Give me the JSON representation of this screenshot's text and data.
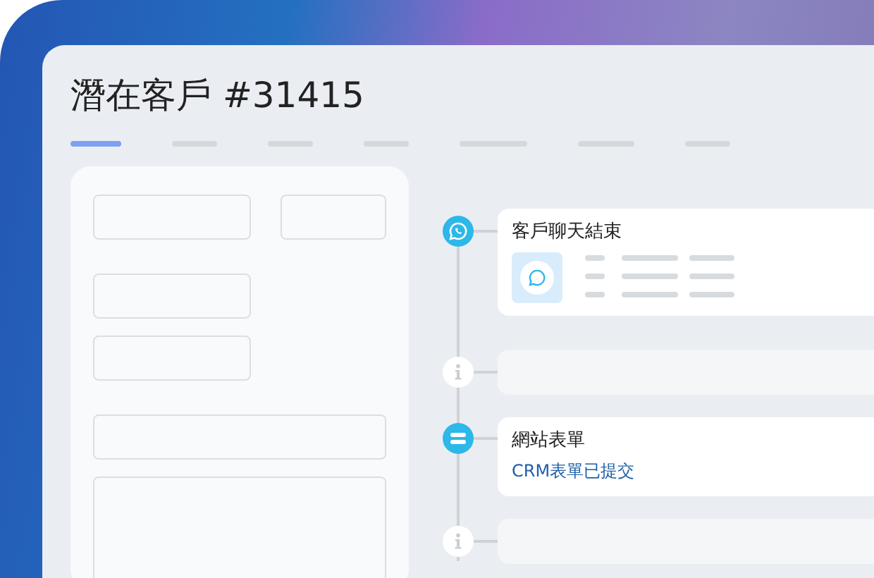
{
  "title": "潛在客戶 #31415",
  "tabs": [
    {
      "selected": true
    },
    {
      "selected": false
    },
    {
      "selected": false
    },
    {
      "selected": false
    },
    {
      "selected": false
    },
    {
      "selected": false
    },
    {
      "selected": false
    }
  ],
  "events": [
    {
      "kind": "chat",
      "title": "客戶聊天結束"
    },
    {
      "kind": "info"
    },
    {
      "kind": "form",
      "title": "網站表單",
      "subtitle": "CRM表單已提交"
    },
    {
      "kind": "info"
    }
  ]
}
